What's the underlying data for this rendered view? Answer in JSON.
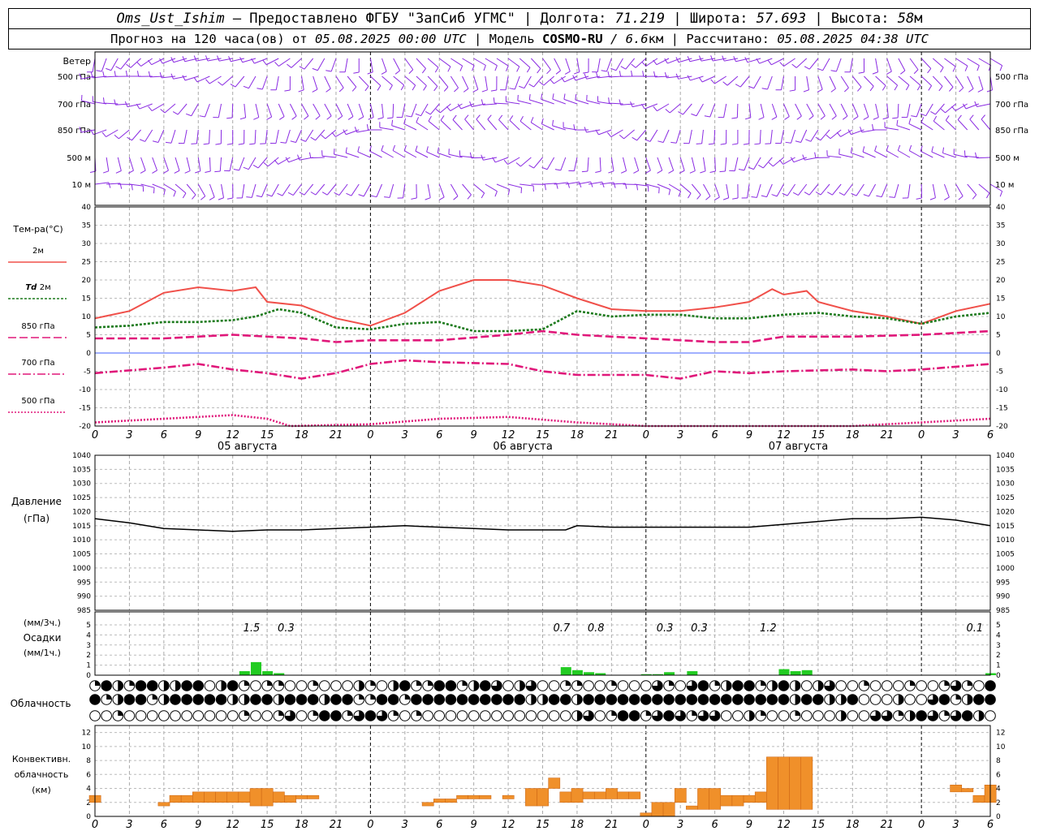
{
  "header": {
    "station": "Oms_Ust_Ishim",
    "provided_by": "– Предоставлено ФГБУ \"ЗапСиб УГМС\"",
    "lon_label": "| Долгота:",
    "lon_value": "71.219",
    "lat_label": "| Широта:",
    "lat_value": "57.693",
    "alt_label": "| Высота:",
    "alt_value": "58",
    "alt_unit": "м",
    "forecast_label": "Прогноз на 120 часа(ов) от",
    "forecast_start": "05.08.2025 00:00 UTC",
    "model_label": "| Модель",
    "model_name": "COSMO-RU",
    "model_res": "/ 6.6",
    "model_res_unit": "км",
    "computed_label": "| Рассчитано:",
    "computed_at": "05.08.2025 04:38 UTC"
  },
  "wind_panel": {
    "title": "Ветер",
    "levels": [
      "500 гПа",
      "700 гПа",
      "850 гПа",
      "500 м",
      "10 м"
    ],
    "color": "#8a2be2"
  },
  "temp_panel": {
    "title": "Тем-ра(°C)",
    "y_ticks": [
      40,
      35,
      30,
      25,
      20,
      15,
      10,
      5,
      0,
      -5,
      -10,
      -15,
      -20
    ],
    "legend": [
      {
        "label": "2м",
        "color": "#f0504a",
        "style": "solid"
      },
      {
        "label_it": "Td",
        "label": "2м",
        "color": "#1e7b1e",
        "style": "dotted"
      },
      {
        "label": "850 гПа",
        "color": "#e0187a",
        "style": "dash"
      },
      {
        "label": "700 гПа",
        "color": "#e0187a",
        "style": "dashdot"
      },
      {
        "label": "500 гПа",
        "color": "#e0187a",
        "style": "dot"
      }
    ],
    "hour_labels": [
      "0",
      "3",
      "6",
      "9",
      "12",
      "15",
      "18",
      "21",
      "0",
      "3",
      "6",
      "9",
      "12",
      "15",
      "18",
      "21",
      "0",
      "3",
      "6",
      "9",
      "12",
      "15",
      "18",
      "21",
      "0",
      "3",
      "6"
    ],
    "day_labels": [
      "05 августа",
      "06 августа",
      "07 августа"
    ]
  },
  "pressure_panel": {
    "title": "Давление",
    "unit": "(гПа)",
    "y_ticks": [
      1040,
      1035,
      1030,
      1025,
      1020,
      1015,
      1010,
      1005,
      1000,
      995,
      990,
      985
    ]
  },
  "precip_panel": {
    "unit_3h": "(мм/3ч.)",
    "title": "Осадки",
    "unit_1h": "(мм/1ч.)",
    "y_ticks": [
      5,
      4,
      3,
      2,
      1,
      0
    ],
    "labels_3h": [
      {
        "hour": 14,
        "text": "1.5"
      },
      {
        "hour": 17,
        "text": "0.3"
      },
      {
        "hour": 41,
        "text": "0.7"
      },
      {
        "hour": 44,
        "text": "0.8"
      },
      {
        "hour": 50,
        "text": "0.3"
      },
      {
        "hour": 53,
        "text": "0.3"
      },
      {
        "hour": 59,
        "text": "1.2"
      },
      {
        "hour": 77,
        "text": "0.1"
      }
    ],
    "color": "#22cc22"
  },
  "cloud_panel": {
    "title": "Облачность"
  },
  "conv_panel": {
    "title_1": "Конвективн.",
    "title_2": "облачность",
    "unit": "(км)",
    "y_ticks": [
      12,
      10,
      8,
      6,
      4,
      2,
      0
    ],
    "color": "#f0902a"
  },
  "chart_data": [
    {
      "type": "line",
      "title": "Тем-ра(°C)",
      "x_unit": "hours from 05.08.2025 00 UTC",
      "ylim": [
        -20,
        40
      ],
      "series": [
        {
          "name": "2м",
          "x": [
            0,
            3,
            6,
            9,
            12,
            14,
            15,
            18,
            21,
            24,
            27,
            30,
            33,
            36,
            39,
            42,
            45,
            48,
            51,
            54,
            57,
            59,
            60,
            62,
            63,
            66,
            69,
            72,
            75,
            78
          ],
          "values": [
            9.5,
            11.5,
            16.5,
            18,
            17,
            18,
            14,
            13,
            9.5,
            7.5,
            11,
            17,
            20,
            20,
            18.5,
            15,
            12,
            11.5,
            11.5,
            12.5,
            14,
            17.5,
            16,
            17,
            14,
            11.5,
            10,
            8,
            11.5,
            13.5
          ]
        },
        {
          "name": "Td 2м",
          "x": [
            0,
            3,
            6,
            9,
            12,
            14,
            16,
            18,
            21,
            24,
            27,
            30,
            33,
            36,
            39,
            42,
            45,
            48,
            51,
            54,
            57,
            60,
            63,
            66,
            69,
            72,
            75,
            78
          ],
          "values": [
            7,
            7.5,
            8.5,
            8.5,
            9,
            10,
            12,
            11,
            7,
            6.5,
            8,
            8.5,
            6,
            6,
            6.5,
            11.5,
            10,
            10.5,
            10.5,
            9.5,
            9.5,
            10.5,
            11,
            10,
            9.5,
            8,
            10,
            11
          ]
        },
        {
          "name": "850 гПа",
          "x": [
            0,
            6,
            12,
            18,
            21,
            24,
            30,
            36,
            39,
            42,
            45,
            48,
            54,
            57,
            60,
            66,
            72,
            78
          ],
          "values": [
            4,
            4,
            5,
            4,
            3,
            3.5,
            3.5,
            5,
            6,
            5,
            4.5,
            4,
            3,
            3,
            4.5,
            4.5,
            5,
            6
          ]
        },
        {
          "name": "700 гПа",
          "x": [
            0,
            6,
            9,
            12,
            15,
            18,
            21,
            24,
            27,
            30,
            36,
            39,
            42,
            48,
            51,
            54,
            57,
            60,
            66,
            69,
            72,
            78
          ],
          "values": [
            -5.5,
            -4,
            -3,
            -4.5,
            -5.5,
            -7,
            -5.5,
            -3,
            -2,
            -2.5,
            -3,
            -5,
            -6,
            -6,
            -7,
            -5,
            -5.5,
            -5,
            -4.5,
            -5,
            -4.5,
            -3
          ]
        },
        {
          "name": "500 гПа",
          "x": [
            0,
            6,
            12,
            15,
            17,
            24,
            30,
            36,
            42,
            48,
            54,
            60,
            66,
            72,
            78
          ],
          "values": [
            -19,
            -18,
            -17,
            -18,
            -20,
            -19.5,
            -18,
            -17.5,
            -19,
            -22,
            -22,
            -22,
            -20,
            -19,
            -18
          ]
        }
      ]
    },
    {
      "type": "line",
      "title": "Давление",
      "ylim": [
        985,
        1040
      ],
      "series": [
        {
          "name": "(гПа)",
          "x": [
            0,
            3,
            6,
            9,
            12,
            15,
            18,
            21,
            24,
            27,
            30,
            33,
            36,
            39,
            41,
            42,
            45,
            48,
            51,
            54,
            57,
            60,
            63,
            66,
            69,
            72,
            75,
            78
          ],
          "values": [
            1017.5,
            1016,
            1014,
            1013.5,
            1013,
            1013.5,
            1013.5,
            1014,
            1014.5,
            1015,
            1014.5,
            1014,
            1013.5,
            1013.5,
            1013.5,
            1015,
            1014.5,
            1014.5,
            1014.5,
            1014.5,
            1014.5,
            1015.5,
            1016.5,
            1017.5,
            1017.5,
            1018,
            1017,
            1015
          ]
        }
      ]
    },
    {
      "type": "bar",
      "title": "Осадки",
      "x_unit": "hours",
      "ylim": [
        0,
        5
      ],
      "x": [
        13,
        14,
        15,
        16,
        41,
        42,
        43,
        44,
        48,
        49,
        50,
        52,
        60,
        61,
        62,
        78
      ],
      "values": [
        0.4,
        1.3,
        0.4,
        0.2,
        0.8,
        0.5,
        0.3,
        0.2,
        0.1,
        0.1,
        0.3,
        0.4,
        0.6,
        0.4,
        0.5,
        0.2
      ]
    },
    {
      "type": "bar",
      "title": "Конвективн. облачность (км)",
      "x_unit": "hours",
      "ylim": [
        0,
        13
      ],
      "bars": [
        [
          0,
          2,
          3
        ],
        [
          6,
          1.5,
          2
        ],
        [
          7,
          2,
          3
        ],
        [
          8,
          2,
          3
        ],
        [
          9,
          2,
          3.5
        ],
        [
          10,
          2,
          3.5
        ],
        [
          11,
          2,
          3.5
        ],
        [
          12,
          2,
          3.5
        ],
        [
          13,
          2,
          3.5
        ],
        [
          14,
          1.5,
          4
        ],
        [
          15,
          1.5,
          4
        ],
        [
          16,
          2,
          3.5
        ],
        [
          17,
          2,
          3
        ],
        [
          18,
          2.5,
          3
        ],
        [
          19,
          2.5,
          3
        ],
        [
          29,
          1.5,
          2
        ],
        [
          30,
          2,
          2.5
        ],
        [
          31,
          2,
          2.5
        ],
        [
          32,
          2.5,
          3
        ],
        [
          33,
          2.5,
          3
        ],
        [
          34,
          2.5,
          3
        ],
        [
          36,
          2.5,
          3
        ],
        [
          38,
          1.5,
          4
        ],
        [
          39,
          1.5,
          4
        ],
        [
          40,
          4,
          5.5
        ],
        [
          41,
          2,
          3.5
        ],
        [
          42,
          2,
          4
        ],
        [
          43,
          2.5,
          3.5
        ],
        [
          44,
          2.5,
          3.5
        ],
        [
          45,
          2.5,
          4
        ],
        [
          46,
          2.5,
          3.5
        ],
        [
          47,
          2.5,
          3.5
        ],
        [
          48,
          0,
          0.5
        ],
        [
          49,
          0,
          2
        ],
        [
          50,
          0,
          2
        ],
        [
          51,
          2,
          4
        ],
        [
          52,
          1,
          1.5
        ],
        [
          53,
          1,
          4
        ],
        [
          54,
          1,
          4
        ],
        [
          55,
          1.5,
          3
        ],
        [
          56,
          1.5,
          3
        ],
        [
          57,
          2,
          3
        ],
        [
          58,
          2,
          3.5
        ],
        [
          59,
          1,
          8.5
        ],
        [
          60,
          1,
          8.5
        ],
        [
          61,
          1,
          8.5
        ],
        [
          62,
          1,
          8.5
        ],
        [
          75,
          3.5,
          4.5
        ],
        [
          76,
          3.5,
          4
        ],
        [
          77,
          2,
          3
        ],
        [
          78,
          2,
          4.5
        ]
      ]
    }
  ]
}
